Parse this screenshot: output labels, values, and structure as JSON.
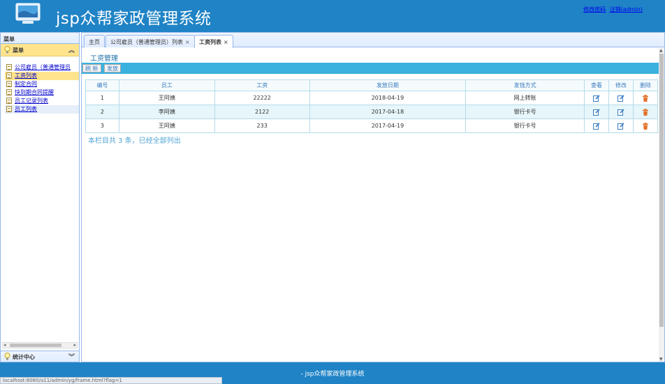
{
  "header": {
    "app_title": "jsp众帮家政管理系统",
    "link_change_password": "修改密码",
    "link_logout": "注销(admin)"
  },
  "sidebar": {
    "title": "菜单",
    "accordion_title": "菜单",
    "items": [
      {
        "label": "公司雇员（普通管理员"
      },
      {
        "label": "工资列表"
      },
      {
        "label": "制定合同"
      },
      {
        "label": "快到期合同提醒"
      },
      {
        "label": "员工记录列表"
      },
      {
        "label": "员工列表"
      }
    ],
    "bottom_title": "统计中心"
  },
  "tabs": [
    {
      "label": "主页"
    },
    {
      "label": "公司雇员（普通管理员）列表"
    },
    {
      "label": "工资列表"
    }
  ],
  "content": {
    "section_title": "工资管理",
    "toolbar": {
      "refresh": "刷 新",
      "issue": "发放"
    },
    "table": {
      "headers": [
        "编号",
        "员工",
        "工资",
        "发放日期",
        "发钱方式",
        "查看",
        "修改",
        "删除"
      ],
      "rows": [
        {
          "id": "1",
          "employee": "王阿姨",
          "salary": "22222",
          "date": "2018-04-19",
          "method": "网上转账"
        },
        {
          "id": "2",
          "employee": "李阿姨",
          "salary": "2122",
          "date": "2017-04-18",
          "method": "银行卡号"
        },
        {
          "id": "3",
          "employee": "王阿姨",
          "salary": "233",
          "date": "2017-04-19",
          "method": "银行卡号"
        }
      ]
    },
    "summary": "本栏目共 3 条，已经全部列出"
  },
  "footer": {
    "text": "- jsp众帮家政管理系统"
  },
  "status_bar": {
    "url": "localhost:8080/a11/admin/yg/frame.html?flag=1"
  },
  "colors": {
    "header_bg": "#1f83c6",
    "toolbar_bg": "#3ab1df",
    "selected_item": "#ffe48d"
  },
  "icons": [
    "logo-icon",
    "bulb-icon",
    "collapse-icon",
    "expand-icon",
    "document-icon",
    "edit-icon",
    "trash-icon"
  ]
}
